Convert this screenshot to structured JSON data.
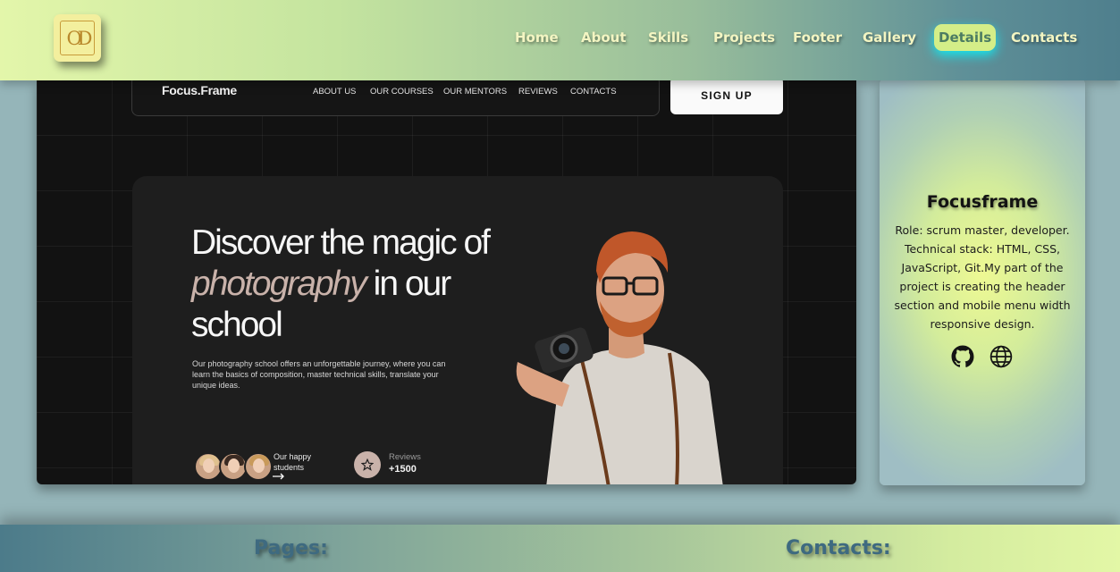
{
  "header": {
    "logo_text": "OD",
    "nav": [
      {
        "label": "Home"
      },
      {
        "label": "About"
      },
      {
        "label": "Skills"
      },
      {
        "label": "Projects"
      },
      {
        "label": "Footer"
      },
      {
        "label": "Gallery"
      },
      {
        "label": "Details",
        "active": true
      },
      {
        "label": "Contacts"
      }
    ]
  },
  "preview": {
    "brand": "Focus.Frame",
    "links": [
      "ABOUT US",
      "OUR COURSES",
      "OUR MENTORS",
      "REVIEWS",
      "CONTACTS"
    ],
    "signup_label": "SIGN UP",
    "hero": {
      "title_start": "Discover the magic of ",
      "title_accent": "photography",
      "title_end": " in our school",
      "description": "Our photography school offers an unforgettable journey, where you can learn the basics of composition, master technical skills, translate your unique ideas.",
      "happy_label": "Our happy students",
      "reviews_label": "Reviews",
      "reviews_count": "+1500"
    }
  },
  "card": {
    "title": "Focusframe",
    "description": "Role: scrum master, developer. Technical stack: HTML, CSS, JavaScript, Git.My part of the project is creating the header section and mobile menu width responsive design.",
    "icons": [
      "github-icon",
      "globe-icon"
    ]
  },
  "footer": {
    "pages_heading": "Pages:",
    "contacts_heading": "Contacts:"
  },
  "colors": {
    "nav_active_bg": "#d4ee88",
    "nav_active_glow": "#14e6ee",
    "nav_text": "#f3f5c2",
    "accent_text": "#c9b2aa",
    "footer_heading": "#3e6a80"
  }
}
